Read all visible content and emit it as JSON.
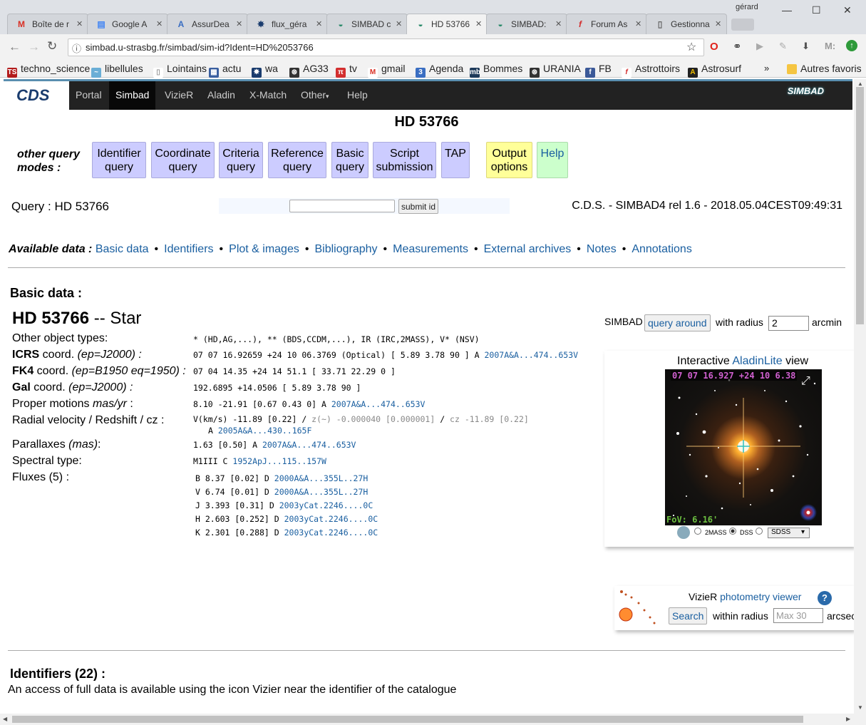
{
  "browser": {
    "user": "gérard",
    "tabs": [
      {
        "title": "Boîte de r",
        "icon": "gmail-icon"
      },
      {
        "title": "Google A",
        "icon": "google-doc-icon"
      },
      {
        "title": "AssurDea",
        "icon": "assur-icon"
      },
      {
        "title": "flux_géra",
        "icon": "flux-icon"
      },
      {
        "title": "SIMBAD c",
        "icon": "simbad-icon"
      },
      {
        "title": "HD 53766",
        "icon": "simbad-icon"
      },
      {
        "title": "SIMBAD:",
        "icon": "simbad-icon"
      },
      {
        "title": "Forum As",
        "icon": "forum-icon"
      },
      {
        "title": "Gestionna",
        "icon": "doc-icon"
      }
    ],
    "url": "simbad.u-strasbg.fr/simbad/sim-id?Ident=HD%2053766",
    "bookmarks": [
      "techno_science",
      "libellules",
      "Lointains",
      "actu",
      "wa",
      "AG33",
      "tv",
      "gmail",
      "Agenda",
      "Bommes",
      "URANIA",
      "FB",
      "Astrottoirs",
      "Astrosurf",
      "Autres favoris"
    ]
  },
  "nav": {
    "logo": "CDS",
    "items": [
      "Portal",
      "Simbad",
      "VizieR",
      "Aladin",
      "X-Match",
      "Other",
      "Help"
    ],
    "brand": "SIMBAD"
  },
  "page": {
    "title": "HD 53766",
    "other_query_modes": "other query modes :",
    "query_buttons": [
      "Identifier query",
      "Coordinate query",
      "Criteria query",
      "Reference query",
      "Basic query",
      "Script submission",
      "TAP",
      "Output options",
      "Help"
    ],
    "query_label": "Query : HD 53766",
    "submit_label": "submit id",
    "release": "C.D.S. - SIMBAD4 rel 1.6 - 2018.05.04CEST09:49:31",
    "available_label": "Available data :",
    "available_links": [
      "Basic data",
      "Identifiers",
      "Plot & images",
      "Bibliography",
      "Measurements",
      "External archives",
      "Notes",
      "Annotations"
    ],
    "basic_heading": "Basic data :",
    "object_id": "HD 53766",
    "object_type": "-- Star",
    "fields": {
      "other_types_label": "Other object types:",
      "other_types_value": "* (HD,AG,...), ** (BDS,CCDM,...), IR (IRC,2MASS), V* (NSV)",
      "icrs_label_b": "ICRS",
      "icrs_label_rest": " coord. ",
      "icrs_label_ep": "(ep=J2000) :",
      "icrs_value": "07 07 16.92659 +24 10 06.3769 (Optical) [ 5.89 3.78 90 ] A ",
      "icrs_ref": "2007A&A...474..653V",
      "fk4_label_b": "FK4",
      "fk4_label_rest": " coord. ",
      "fk4_label_ep": "(ep=B1950 eq=1950) :",
      "fk4_value": "07 04 14.35 +24 14 51.1 [ 33.71 22.29 0 ]",
      "gal_label_b": "Gal",
      "gal_label_rest": " coord. ",
      "gal_label_ep": "(ep=J2000) :",
      "gal_value": "192.6895 +14.0506 [ 5.89 3.78 90 ]",
      "pm_label": "Proper motions ",
      "pm_label_unit": "mas/yr",
      "pm_label_end": " :",
      "pm_value": "8.10 -21.91 [0.67 0.43 0] A ",
      "pm_ref": "2007A&A...474..653V",
      "rv_label": "Radial velocity / Redshift / cz :",
      "rv_value": "V(km/s) -11.89 [0.22] / ",
      "rv_z": "z(~) -0.000040 [0.000001]",
      "rv_sep": " / ",
      "rv_cz": "cz -11.89 [0.22]",
      "rv_q": "A ",
      "rv_ref": "2005A&A...430..165F",
      "plx_label": "Parallaxes ",
      "plx_label_unit": "(mas)",
      "plx_label_end": ":",
      "plx_value": "1.63 [0.50] A ",
      "plx_ref": "2007A&A...474..653V",
      "sp_label": "Spectral type:",
      "sp_value": "M1III C ",
      "sp_ref": "1952ApJ...115..157W",
      "flux_label": "Fluxes (5) :"
    },
    "fluxes": [
      {
        "v": "B 8.37 [0.02] D ",
        "ref": "2000A&A...355L..27H"
      },
      {
        "v": "V 6.74 [0.01] D ",
        "ref": "2000A&A...355L..27H"
      },
      {
        "v": "J 3.393 [0.31] D ",
        "ref": "2003yCat.2246....0C"
      },
      {
        "v": "H 2.603 [0.252] D ",
        "ref": "2003yCat.2246....0C"
      },
      {
        "v": "K 2.301 [0.288] D ",
        "ref": "2003yCat.2246....0C"
      }
    ],
    "around": {
      "simbad": "SIMBAD",
      "button": "query around",
      "with_radius": "with radius",
      "radius": "2",
      "unit": "arcmin"
    },
    "aladin": {
      "pre": "Interactive ",
      "link": "AladinLite",
      "post": " view",
      "coord": "07 07 16.927 +24 10 6.38",
      "fov": "FoV: 6.16'",
      "surveys": [
        "2MASS",
        "DSS"
      ],
      "selected": "DSS",
      "select_value": "SDSS"
    },
    "vizier": {
      "pre": "VizieR ",
      "link": "photometry viewer",
      "help": "?",
      "search": "Search",
      "within": "within radius",
      "placeholder": "Max 30",
      "unit": "arcsec"
    },
    "ident_heading": "Identifiers (22) :",
    "ident_note": "An access of full data is available using the icon Vizier near the identifier of the catalogue"
  }
}
